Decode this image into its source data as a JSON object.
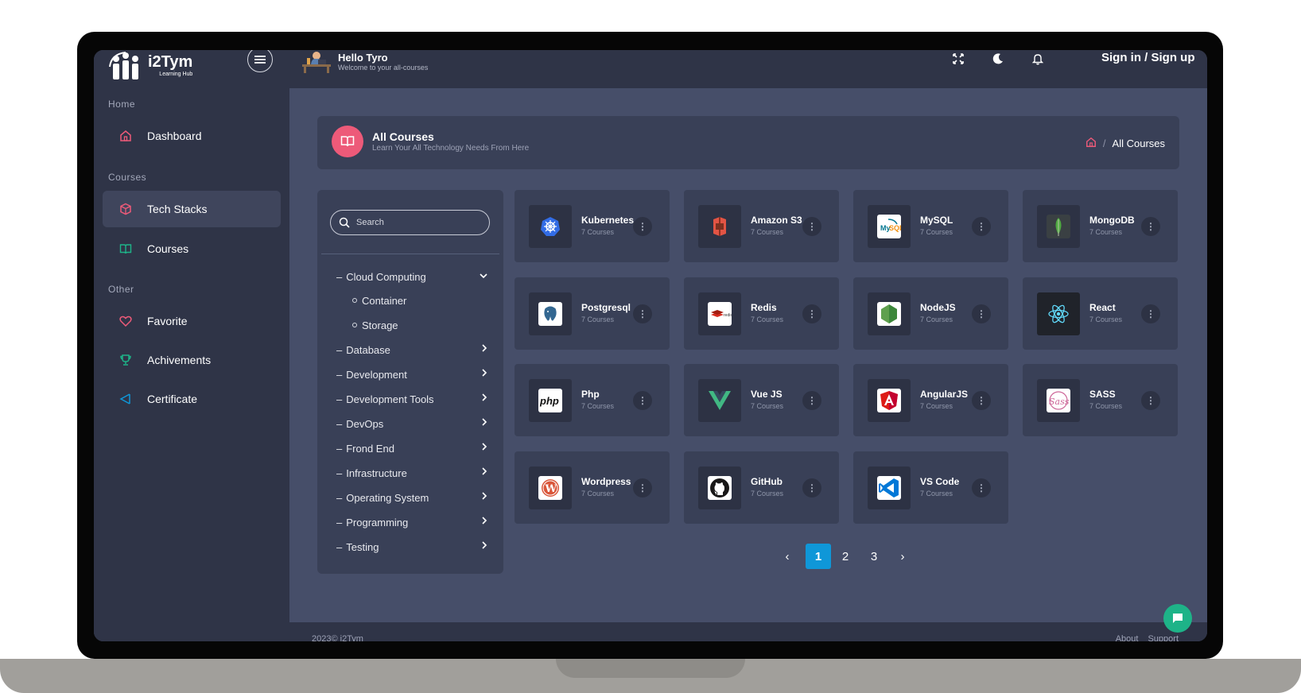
{
  "brand": {
    "name": "i2Tym",
    "tagline": "Learning Hub"
  },
  "topbar": {
    "greeting_title": "Hello Tyro",
    "greeting_subtitle": "Welcome to your all-courses",
    "sign_in_label": "Sign in / Sign up"
  },
  "sidebar": {
    "sections": [
      {
        "title": "Home"
      },
      {
        "title": "Courses"
      },
      {
        "title": "Other"
      }
    ],
    "items": [
      {
        "label": "Dashboard",
        "icon": "home-icon",
        "color": "#ed5a79"
      },
      {
        "label": "Tech Stacks",
        "icon": "box-icon",
        "color": "#ed5a79"
      },
      {
        "label": "Courses",
        "icon": "book-icon",
        "color": "#1eb388"
      },
      {
        "label": "Favorite",
        "icon": "heart-icon",
        "color": "#ed5a79"
      },
      {
        "label": "Achivements",
        "icon": "trophy-icon",
        "color": "#1eb388"
      },
      {
        "label": "Certificate",
        "icon": "send-icon",
        "color": "#0f97d8"
      }
    ]
  },
  "header": {
    "title": "All Courses",
    "subtitle": "Learn Your All Technology Needs From Here",
    "breadcrumb_separator": "/",
    "breadcrumb_current": "All Courses"
  },
  "filter": {
    "search_placeholder": "Search",
    "categories": [
      {
        "label": "Cloud Computing",
        "expanded": true
      },
      {
        "label": "Database"
      },
      {
        "label": "Development"
      },
      {
        "label": "Development Tools"
      },
      {
        "label": "DevOps"
      },
      {
        "label": "Frond End"
      },
      {
        "label": "Infrastructure"
      },
      {
        "label": "Operating System"
      },
      {
        "label": "Programming"
      },
      {
        "label": "Testing"
      }
    ],
    "subcategories": [
      {
        "label": "Container"
      },
      {
        "label": "Storage"
      }
    ]
  },
  "courses": [
    {
      "name": "Kubernetes",
      "count": "7 Courses",
      "icon": "kubernetes-icon",
      "color": "#326ce5"
    },
    {
      "name": "Amazon S3",
      "count": "7 Courses",
      "icon": "amazon-s3-icon",
      "color": "#e25444"
    },
    {
      "name": "MySQL",
      "count": "7 Courses",
      "icon": "mysql-icon",
      "color": "#00758f"
    },
    {
      "name": "MongoDB",
      "count": "7 Courses",
      "icon": "mongodb-icon",
      "color": "#4faa41"
    },
    {
      "name": "Postgresql",
      "count": "7 Courses",
      "icon": "postgresql-icon",
      "color": "#336791"
    },
    {
      "name": "Redis",
      "count": "7 Courses",
      "icon": "redis-icon",
      "color": "#d82c20"
    },
    {
      "name": "NodeJS",
      "count": "7 Courses",
      "icon": "nodejs-icon",
      "color": "#5fa04e"
    },
    {
      "name": "React",
      "count": "7 Courses",
      "icon": "react-icon",
      "color": "#61dafb"
    },
    {
      "name": "Php",
      "count": "7 Courses",
      "icon": "php-icon",
      "color": "#ffffff"
    },
    {
      "name": "Vue JS",
      "count": "7 Courses",
      "icon": "vue-icon",
      "color": "#41b883"
    },
    {
      "name": "AngularJS",
      "count": "7 Courses",
      "icon": "angular-icon",
      "color": "#dd1b16"
    },
    {
      "name": "SASS",
      "count": "7 Courses",
      "icon": "sass-icon",
      "color": "#cd6799"
    },
    {
      "name": "Wordpress",
      "count": "7 Courses",
      "icon": "wordpress-icon",
      "color": "#d9563a"
    },
    {
      "name": "GitHub",
      "count": "7 Courses",
      "icon": "github-icon",
      "color": "#181717"
    },
    {
      "name": "VS Code",
      "count": "7 Courses",
      "icon": "vscode-icon",
      "color": "#0078d7"
    }
  ],
  "pagination": {
    "prev": "‹",
    "pages": [
      "1",
      "2",
      "3"
    ],
    "current": "1",
    "next": "›"
  },
  "footer": {
    "copyright": "2023© i2Tym",
    "links": [
      "About",
      "Support"
    ]
  },
  "colors": {
    "accent": "#ed5a79",
    "primary": "#0f97d8",
    "success": "#1eb388"
  }
}
